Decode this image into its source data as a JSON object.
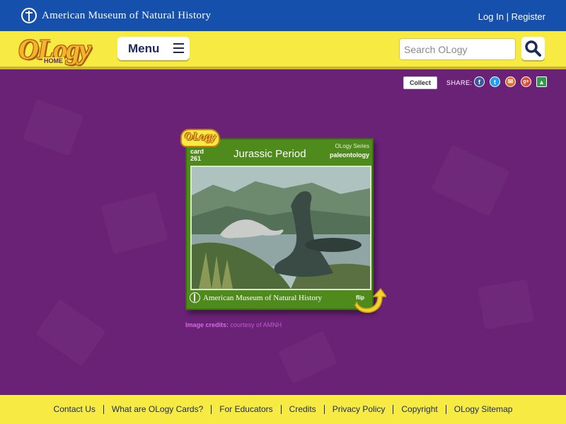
{
  "topbar": {
    "museum_name": "American Museum of Natural History",
    "login": "Log In",
    "separator": "|",
    "register": "Register"
  },
  "nav": {
    "logo_word": "OLogy",
    "logo_sub": "HOME",
    "menu_label": "Menu",
    "search_placeholder": "Search OLogy"
  },
  "share": {
    "collect_label": "Collect",
    "share_label": "SHARE:",
    "icons": [
      "facebook-icon",
      "twitter-icon",
      "email-icon",
      "google-plus-icon",
      "classroom-icon"
    ]
  },
  "card": {
    "badge": "OLogy",
    "card_label": "card",
    "card_number": "261",
    "title": "Jurassic Period",
    "series_label": "OLogy Series",
    "series_name": "paleontology",
    "footer_text": "American Museum of Natural History",
    "flip_label": "flip",
    "credit_label": "Image credits:",
    "credit_text": "courtesy of AMNH"
  },
  "footer": {
    "links": [
      "Contact Us",
      "What are OLogy Cards?",
      "For Educators",
      "Credits",
      "Privacy Policy",
      "Copyright",
      "OLogy Sitemap"
    ]
  },
  "colors": {
    "topbar": "#1550ac",
    "yellow": "#f6ea43",
    "purple": "#6a2277",
    "card_green": "#4f8a1c"
  }
}
